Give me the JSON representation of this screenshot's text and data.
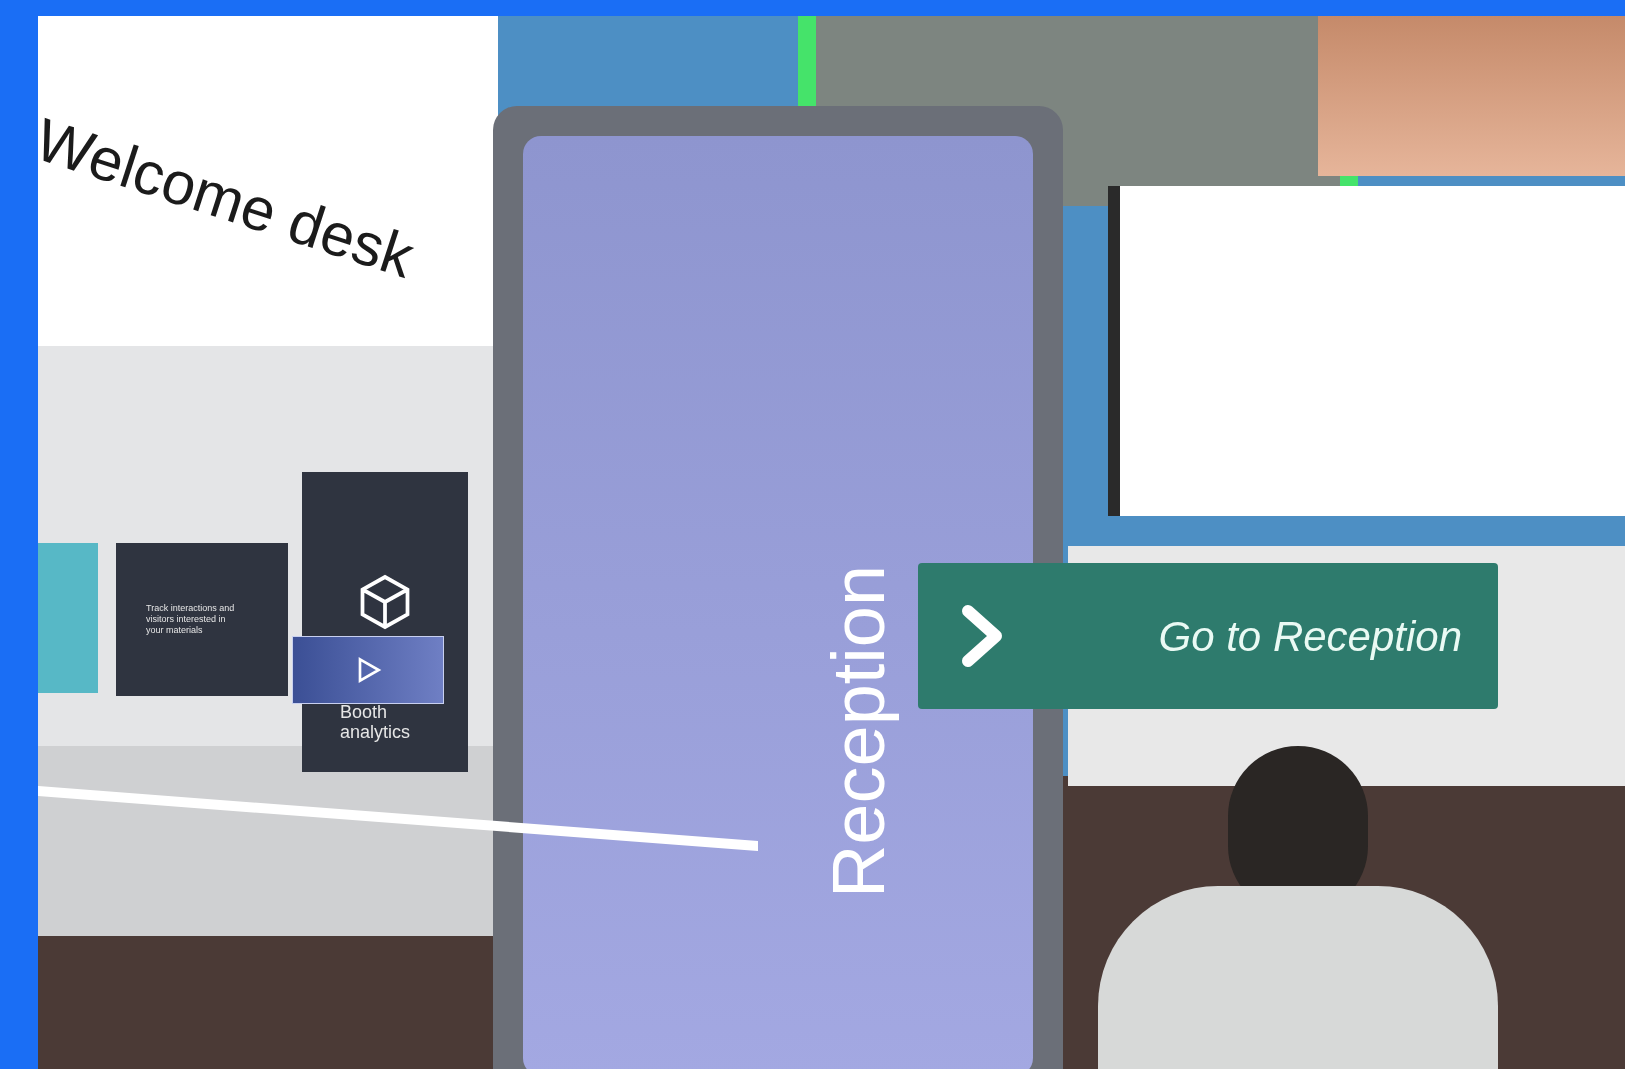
{
  "welcome_sign": {
    "text": "Welcome desk"
  },
  "booth_panels": {
    "info_text": "Track interactions and visitors interested in your materials",
    "analytics_label": "Booth analytics"
  },
  "kiosk": {
    "title": "Reception"
  },
  "navigation_button": {
    "label": "Go to Reception"
  }
}
